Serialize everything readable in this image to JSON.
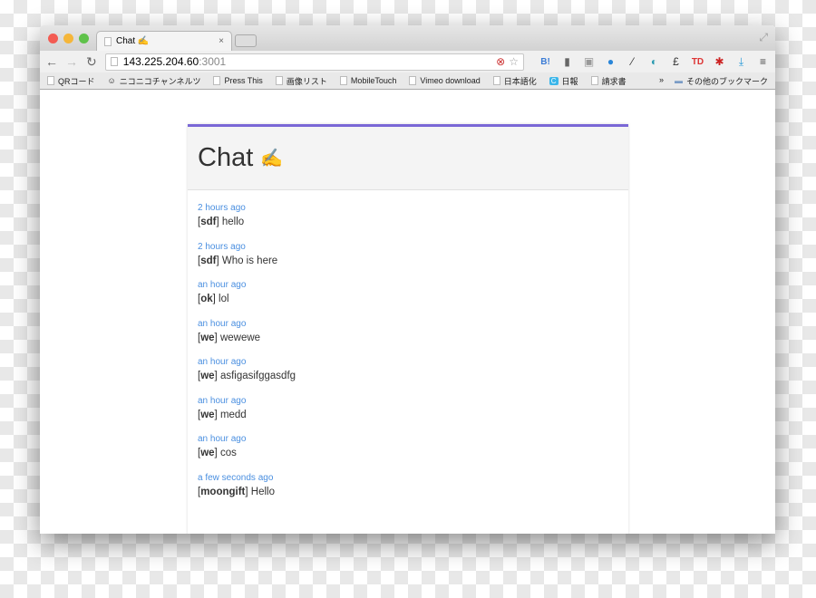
{
  "browser": {
    "tab_title": "Chat ✍",
    "url_host": "143.225.204.60",
    "url_port": ":3001",
    "bookmarks": [
      "QRコード",
      "ニコニコチャンネルツ",
      "Press This",
      "画像リスト",
      "MobileTouch",
      "Vimeo download",
      "日本語化",
      "日報",
      "請求書"
    ],
    "overflow": "»",
    "other_bookmarks": "その他のブックマーク"
  },
  "chat": {
    "title": "Chat",
    "title_icon": "✍",
    "messages": [
      {
        "time": "2 hours ago",
        "user": "sdf",
        "text": "hello"
      },
      {
        "time": "2 hours ago",
        "user": "sdf",
        "text": "Who is here"
      },
      {
        "time": "an hour ago",
        "user": "ok",
        "text": "lol"
      },
      {
        "time": "an hour ago",
        "user": "we",
        "text": "wewewe"
      },
      {
        "time": "an hour ago",
        "user": "we",
        "text": "asfigasifggasdfg"
      },
      {
        "time": "an hour ago",
        "user": "we",
        "text": "medd"
      },
      {
        "time": "an hour ago",
        "user": "we",
        "text": "cos"
      },
      {
        "time": "a few seconds ago",
        "user": "moongift",
        "text": "Hello"
      }
    ]
  },
  "colors": {
    "accent": "#7a68d6",
    "timestamp": "#4a8fe0"
  }
}
